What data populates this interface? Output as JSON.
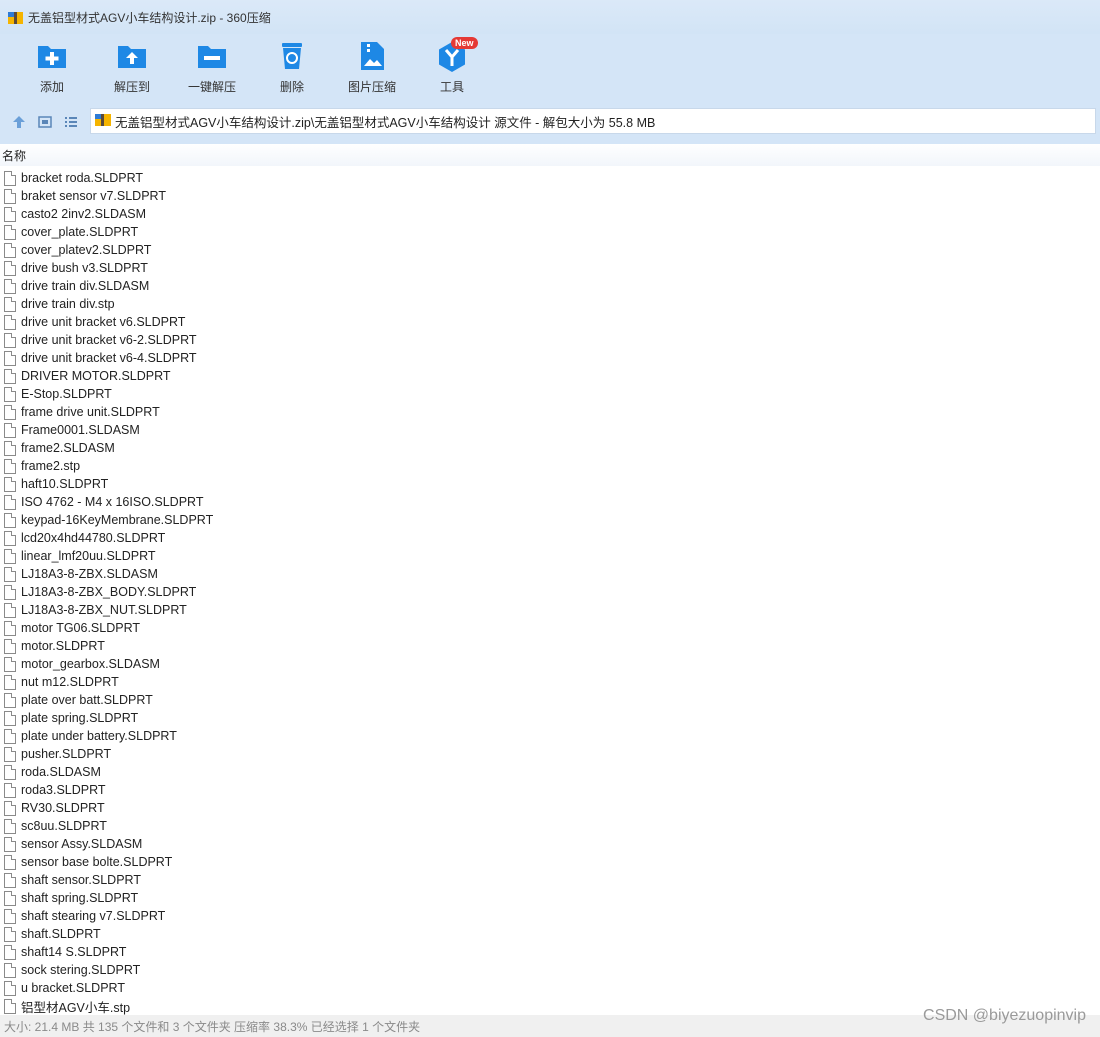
{
  "window": {
    "title": "无盖铝型材式AGV小车结构设计.zip - 360压缩",
    "icon": "archive-icon"
  },
  "toolbar": {
    "items": [
      {
        "label": "添加",
        "icon": "add-icon"
      },
      {
        "label": "解压到",
        "icon": "extract-to-icon"
      },
      {
        "label": "一键解压",
        "icon": "one-click-extract-icon"
      },
      {
        "label": "删除",
        "icon": "delete-icon"
      },
      {
        "label": "图片压缩",
        "icon": "image-compress-icon"
      },
      {
        "label": "工具",
        "icon": "tools-icon"
      }
    ],
    "new_badge": "New"
  },
  "navbar": {
    "path": "无盖铝型材式AGV小车结构设计.zip\\无盖铝型材式AGV小车结构设计 源文件 - 解包大小为 55.8 MB"
  },
  "list": {
    "column_name": "名称",
    "files": [
      "bracket roda.SLDPRT",
      "braket sensor v7.SLDPRT",
      "casto2 2inv2.SLDASM",
      "cover_plate.SLDPRT",
      "cover_platev2.SLDPRT",
      "drive bush v3.SLDPRT",
      "drive train div.SLDASM",
      "drive train div.stp",
      "drive unit bracket v6.SLDPRT",
      "drive unit bracket v6-2.SLDPRT",
      "drive unit bracket v6-4.SLDPRT",
      "DRIVER MOTOR.SLDPRT",
      "E-Stop.SLDPRT",
      "frame drive unit.SLDPRT",
      "Frame0001.SLDASM",
      "frame2.SLDASM",
      "frame2.stp",
      "haft10.SLDPRT",
      "ISO 4762 - M4 x 16ISO.SLDPRT",
      "keypad-16KeyMembrane.SLDPRT",
      "lcd20x4hd44780.SLDPRT",
      "linear_lmf20uu.SLDPRT",
      "LJ18A3-8-ZBX.SLDASM",
      "LJ18A3-8-ZBX_BODY.SLDPRT",
      "LJ18A3-8-ZBX_NUT.SLDPRT",
      "motor TG06.SLDPRT",
      "motor.SLDPRT",
      "motor_gearbox.SLDASM",
      "nut m12.SLDPRT",
      "plate over batt.SLDPRT",
      "plate spring.SLDPRT",
      "plate under battery.SLDPRT",
      "pusher.SLDPRT",
      "roda.SLDASM",
      "roda3.SLDPRT",
      "RV30.SLDPRT",
      "sc8uu.SLDPRT",
      "sensor Assy.SLDASM",
      "sensor base bolte.SLDPRT",
      "shaft sensor.SLDPRT",
      "shaft spring.SLDPRT",
      "shaft stearing v7.SLDPRT",
      "shaft.SLDPRT",
      "shaft14 S.SLDPRT",
      "sock stering.SLDPRT",
      "u bracket.SLDPRT",
      "铝型材AGV小车.stp"
    ]
  },
  "status": {
    "text": "大小: 21.4 MB 共 135 个文件和 3 个文件夹 压缩率 38.3% 已经选择 1 个文件夹"
  },
  "watermark": "CSDN @biyezuopinvip",
  "colors": {
    "toolbar_bg": "#d4e5f7",
    "icon_blue": "#1e88e5",
    "badge_red": "#e53935"
  }
}
